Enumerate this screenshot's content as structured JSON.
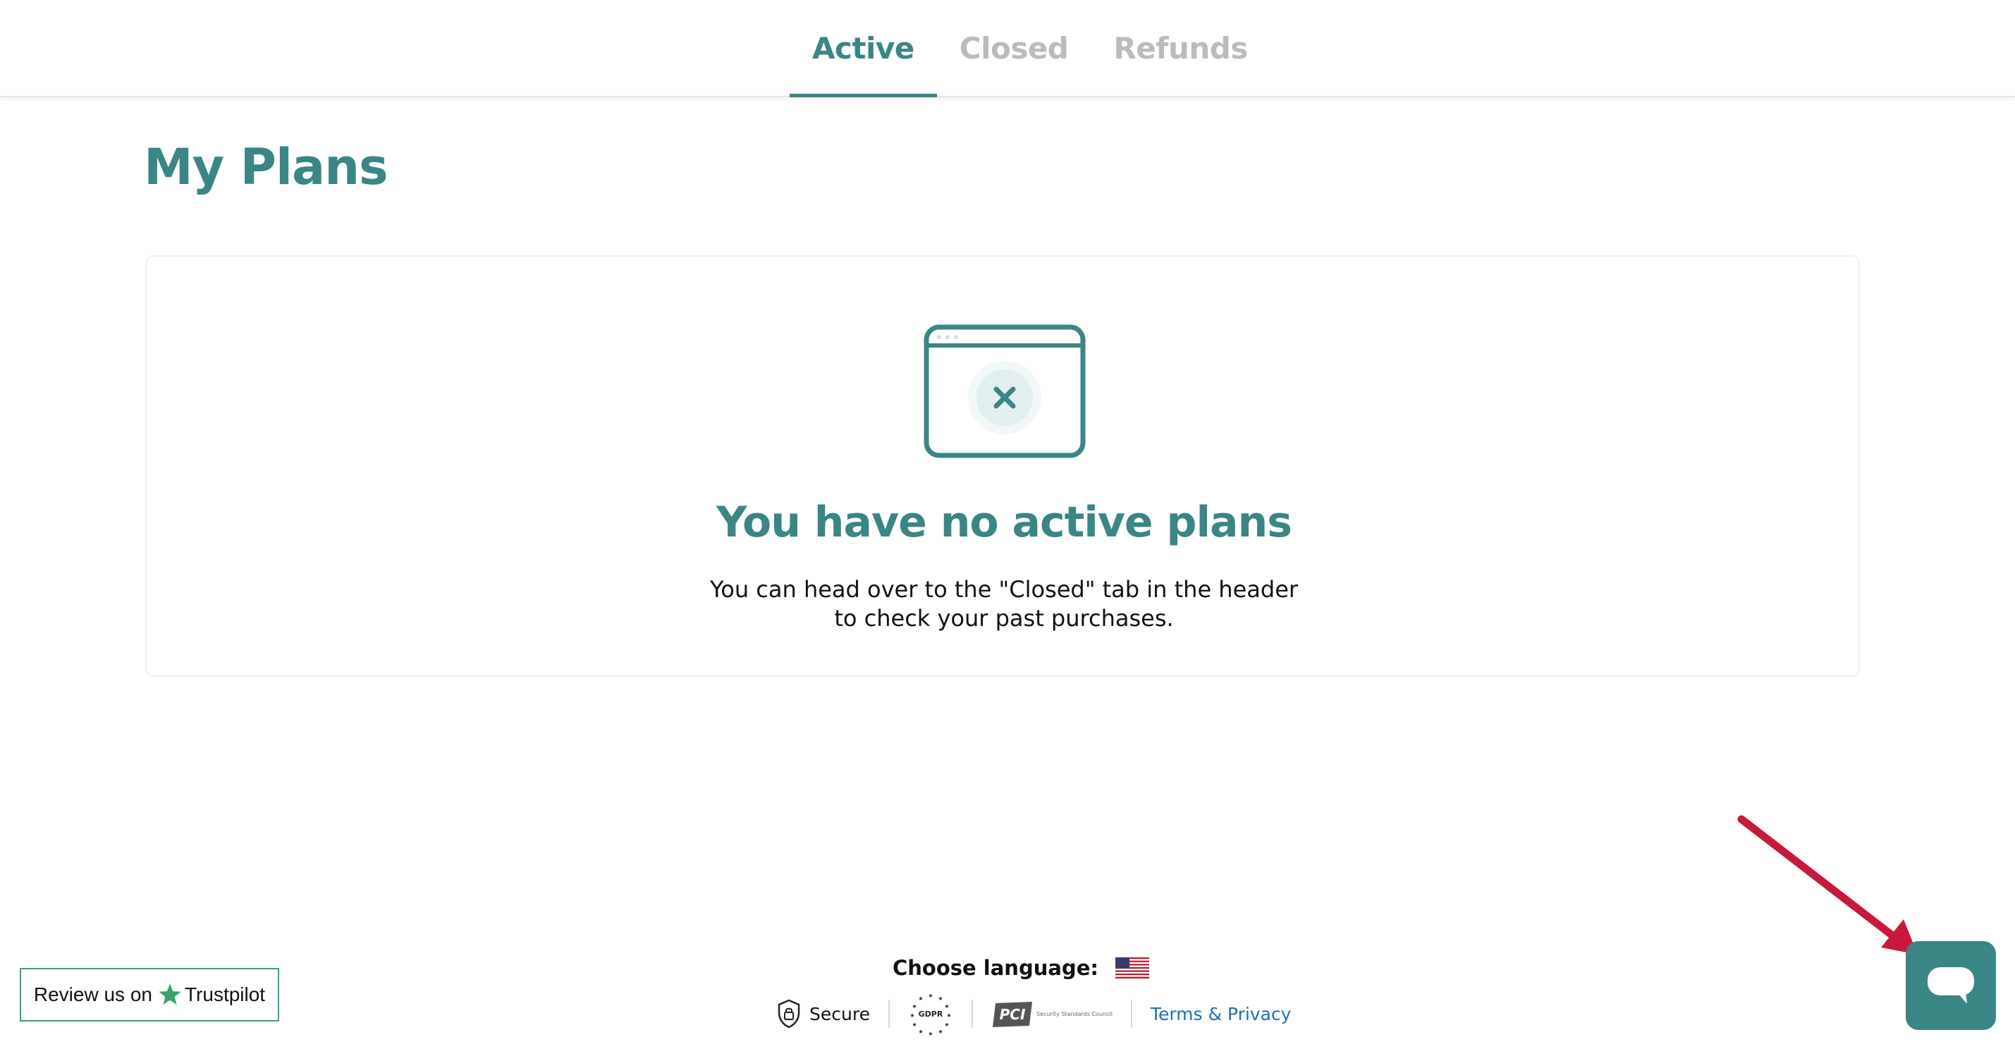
{
  "tabs": [
    {
      "label": "Active",
      "active": true
    },
    {
      "label": "Closed",
      "active": false
    },
    {
      "label": "Refunds",
      "active": false
    }
  ],
  "page_title": "My Plans",
  "empty_state": {
    "icon": "browser-window-x-icon",
    "title": "You have no active plans",
    "description_line1": "You can head over to the \"Closed\" tab in the header",
    "description_line2": "to check your past purchases."
  },
  "footer": {
    "language_label": "Choose language:",
    "language_flag": "us-flag-icon",
    "secure_label": "Secure",
    "gdpr_label": "GDPR",
    "pci_label": "PCI",
    "pci_subtext": "Security Standards Council",
    "terms_label": "Terms & Privacy"
  },
  "trustpilot": {
    "prefix": "Review us on",
    "brand": "Trustpilot"
  },
  "chat_button": {
    "icon": "chat-bubble-icon"
  },
  "colors": {
    "brand": "#3a8585",
    "inactive_tab": "#b9bcbe",
    "link": "#1f6fb5",
    "trustpilot_green": "#3ba36b",
    "annotation_arrow": "#c8193c"
  }
}
